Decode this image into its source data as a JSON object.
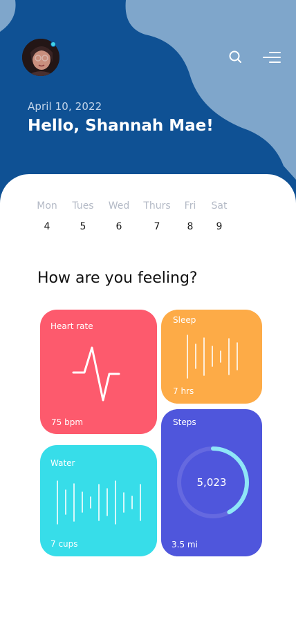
{
  "header": {
    "date": "April 10, 2022",
    "greeting": "Hello, Shannah Mae!",
    "search_icon": "search-icon",
    "menu_icon": "menu-icon"
  },
  "week": [
    {
      "day": "Mon",
      "num": "4"
    },
    {
      "day": "Tues",
      "num": "5"
    },
    {
      "day": "Wed",
      "num": "6"
    },
    {
      "day": "Thurs",
      "num": "7"
    },
    {
      "day": "Fri",
      "num": "8"
    },
    {
      "day": "Sat",
      "num": "9"
    }
  ],
  "section_title": "How are you feeling?",
  "cards": {
    "heart": {
      "label": "Heart rate",
      "value": "75 bpm"
    },
    "sleep": {
      "label": "Sleep",
      "value": "7 hrs"
    },
    "water": {
      "label": "Water",
      "value": "7 cups"
    },
    "steps": {
      "label": "Steps",
      "count": "5,023",
      "distance": "3.5 mi",
      "progress": 0.42
    }
  },
  "colors": {
    "header": "#0f5194",
    "heart": "#fd5a6d",
    "sleep": "#fdab47",
    "water": "#37dde9",
    "steps": "#4f56dc",
    "steps_ring": "#8fe6f7"
  }
}
